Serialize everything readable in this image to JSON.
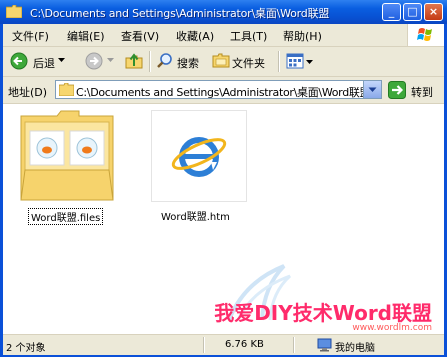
{
  "window": {
    "title": "C:\\Documents and Settings\\Administrator\\桌面\\Word联盟",
    "minimize_glyph": "_",
    "maximize_glyph": "□",
    "close_glyph": "×"
  },
  "menu": {
    "items": [
      {
        "label": "文件(F)"
      },
      {
        "label": "编辑(E)"
      },
      {
        "label": "查看(V)"
      },
      {
        "label": "收藏(A)"
      },
      {
        "label": "工具(T)"
      },
      {
        "label": "帮助(H)"
      }
    ]
  },
  "toolbar": {
    "back_label": "后退",
    "search_label": "搜索",
    "folders_label": "文件夹"
  },
  "address": {
    "label": "地址(D)",
    "path": "C:\\Documents and Settings\\Administrator\\桌面\\Word联盟",
    "go_label": "转到"
  },
  "files": [
    {
      "name": "Word联盟.files",
      "icon": "folder-icon",
      "selected": true
    },
    {
      "name": "Word联盟.htm",
      "icon": "ie-html-icon",
      "selected": false
    }
  ],
  "watermark": {
    "text": "我爱DIY技术Word联盟",
    "url": "www.wordlm.com"
  },
  "status": {
    "count": "2 个对象",
    "size": "6.76 KB",
    "location": "我的电脑"
  },
  "colors": {
    "titlebar": "#0a5ee0",
    "chrome": "#ece9d8",
    "accent_blue": "#316ac5"
  }
}
